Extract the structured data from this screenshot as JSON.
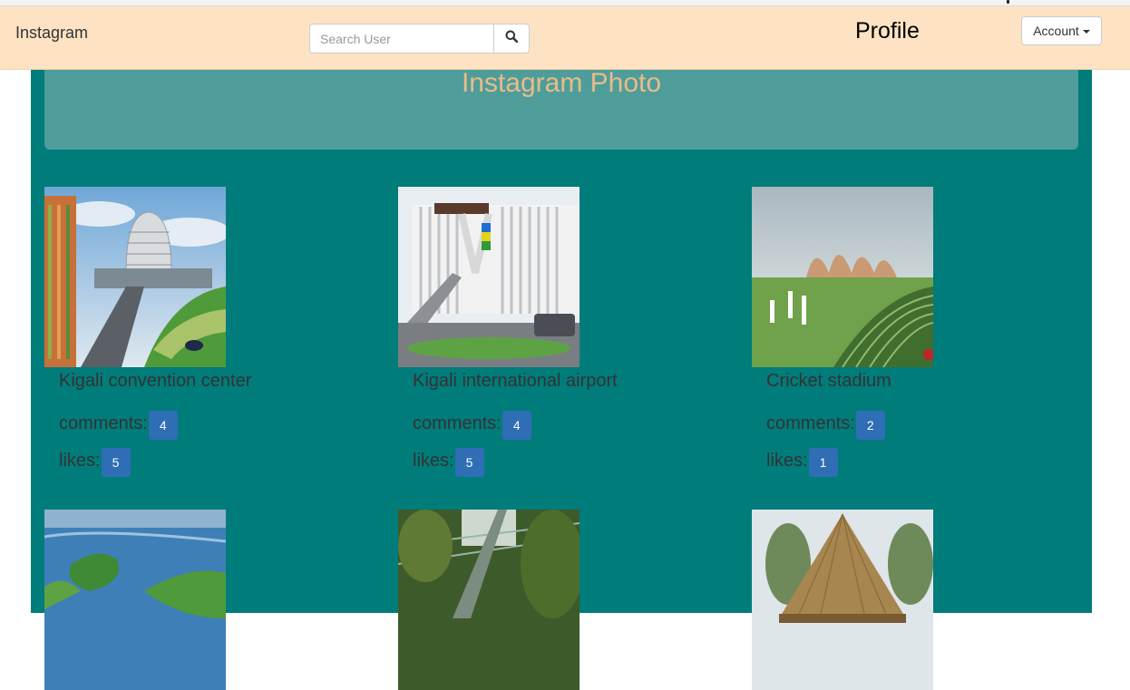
{
  "navbar": {
    "brand": "Instagram",
    "search": {
      "placeholder": "Search User",
      "value": ""
    },
    "search_icon": "search-icon",
    "profile_label": "Profile",
    "account_label": "Account"
  },
  "header": {
    "title": "Instagram Photo"
  },
  "posts": [
    {
      "caption": "Kigali convention center",
      "comments_label": "comments:",
      "comments": "4",
      "likes_label": "likes:",
      "likes": "5"
    },
    {
      "caption": "Kigali international airport",
      "comments_label": "comments:",
      "comments": "4",
      "likes_label": "likes:",
      "likes": "5"
    },
    {
      "caption": "Cricket stadium",
      "comments_label": "comments:",
      "comments": "2",
      "likes_label": "likes:",
      "likes": "1"
    },
    {
      "caption": "",
      "comments_label": "",
      "comments": "",
      "likes_label": "",
      "likes": ""
    },
    {
      "caption": "",
      "comments_label": "",
      "comments": "",
      "likes_label": "",
      "likes": ""
    },
    {
      "caption": "",
      "comments_label": "",
      "comments": "",
      "likes_label": "",
      "likes": ""
    }
  ],
  "colors": {
    "navbar_bg": "#fde3c3",
    "main_bg": "#007c7a",
    "jumbotron_bg": "#4f9d9b",
    "title_color": "#e8bc87",
    "badge_bg": "#2f6db5"
  }
}
